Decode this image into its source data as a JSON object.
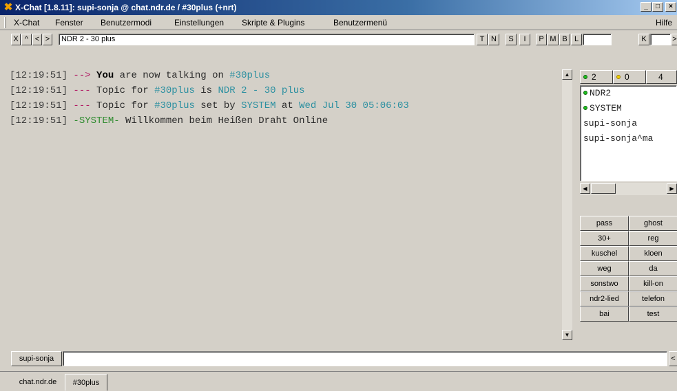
{
  "window": {
    "title": "X-Chat [1.8.11]: supi-sonja @ chat.ndr.de / #30plus (+nrt)",
    "app_icon": "xchat-x-icon",
    "minimize": "_",
    "maximize": "□",
    "close": "×"
  },
  "menubar": {
    "items": [
      "X-Chat",
      "Fenster",
      "Benutzermodi",
      "Einstellungen",
      "Skripte & Plugins",
      "Benutzermenü"
    ],
    "help": "Hilfe"
  },
  "topicbar": {
    "nav": [
      "X",
      "^",
      "<",
      ">"
    ],
    "topic": "NDR 2 - 30 plus",
    "modes": [
      "T",
      "N",
      "S",
      "I",
      "P",
      "M",
      "B",
      "L"
    ],
    "limit_value": "",
    "key_label": "K",
    "key_value": "",
    "more": ">"
  },
  "chat": {
    "lines": [
      {
        "ts": "[12:19:51]",
        "marker": "-->",
        "parts": [
          {
            "t": "You",
            "c": "bold"
          },
          {
            "t": " are now talking on ",
            "c": ""
          },
          {
            "t": "#30plus",
            "c": "chan"
          }
        ]
      },
      {
        "ts": "[12:19:51]",
        "marker": "---",
        "parts": [
          {
            "t": "Topic for ",
            "c": ""
          },
          {
            "t": "#30plus",
            "c": "chan"
          },
          {
            "t": " is ",
            "c": ""
          },
          {
            "t": "NDR 2 - 30 plus",
            "c": "nick"
          }
        ]
      },
      {
        "ts": "[12:19:51]",
        "marker": "---",
        "parts": [
          {
            "t": "Topic for ",
            "c": ""
          },
          {
            "t": "#30plus",
            "c": "chan"
          },
          {
            "t": " set by ",
            "c": ""
          },
          {
            "t": "SYSTEM",
            "c": "nick"
          },
          {
            "t": " at ",
            "c": ""
          },
          {
            "t": "Wed Jul 30 05:06:03",
            "c": "nick"
          }
        ]
      },
      {
        "ts": "[12:19:51]",
        "marker": "-SYSTEM-",
        "parts": [
          {
            "t": " Willkommen beim Heißen Draht Online",
            "c": ""
          }
        ]
      }
    ]
  },
  "userpanel": {
    "ops_count": "2",
    "voice_count": "0",
    "total_count": "4",
    "colors": {
      "op": "#20c020",
      "voice": "#f0d000"
    },
    "users": [
      {
        "name": "NDR2",
        "status": "op"
      },
      {
        "name": "SYSTEM",
        "status": "op"
      },
      {
        "name": "supi-sonja",
        "status": ""
      },
      {
        "name": "supi-sonja^ma",
        "status": ""
      }
    ],
    "buttons": [
      "pass",
      "ghost",
      "30+",
      "reg",
      "kuschel",
      "kloen",
      "weg",
      "da",
      "sonstwo",
      "kill-on",
      "ndr2-lied",
      "telefon",
      "bai",
      "test"
    ]
  },
  "inputbar": {
    "nick": "supi-sonja",
    "message": "",
    "more": "<"
  },
  "tabs": {
    "server": "chat.ndr.de",
    "channel": "#30plus"
  }
}
